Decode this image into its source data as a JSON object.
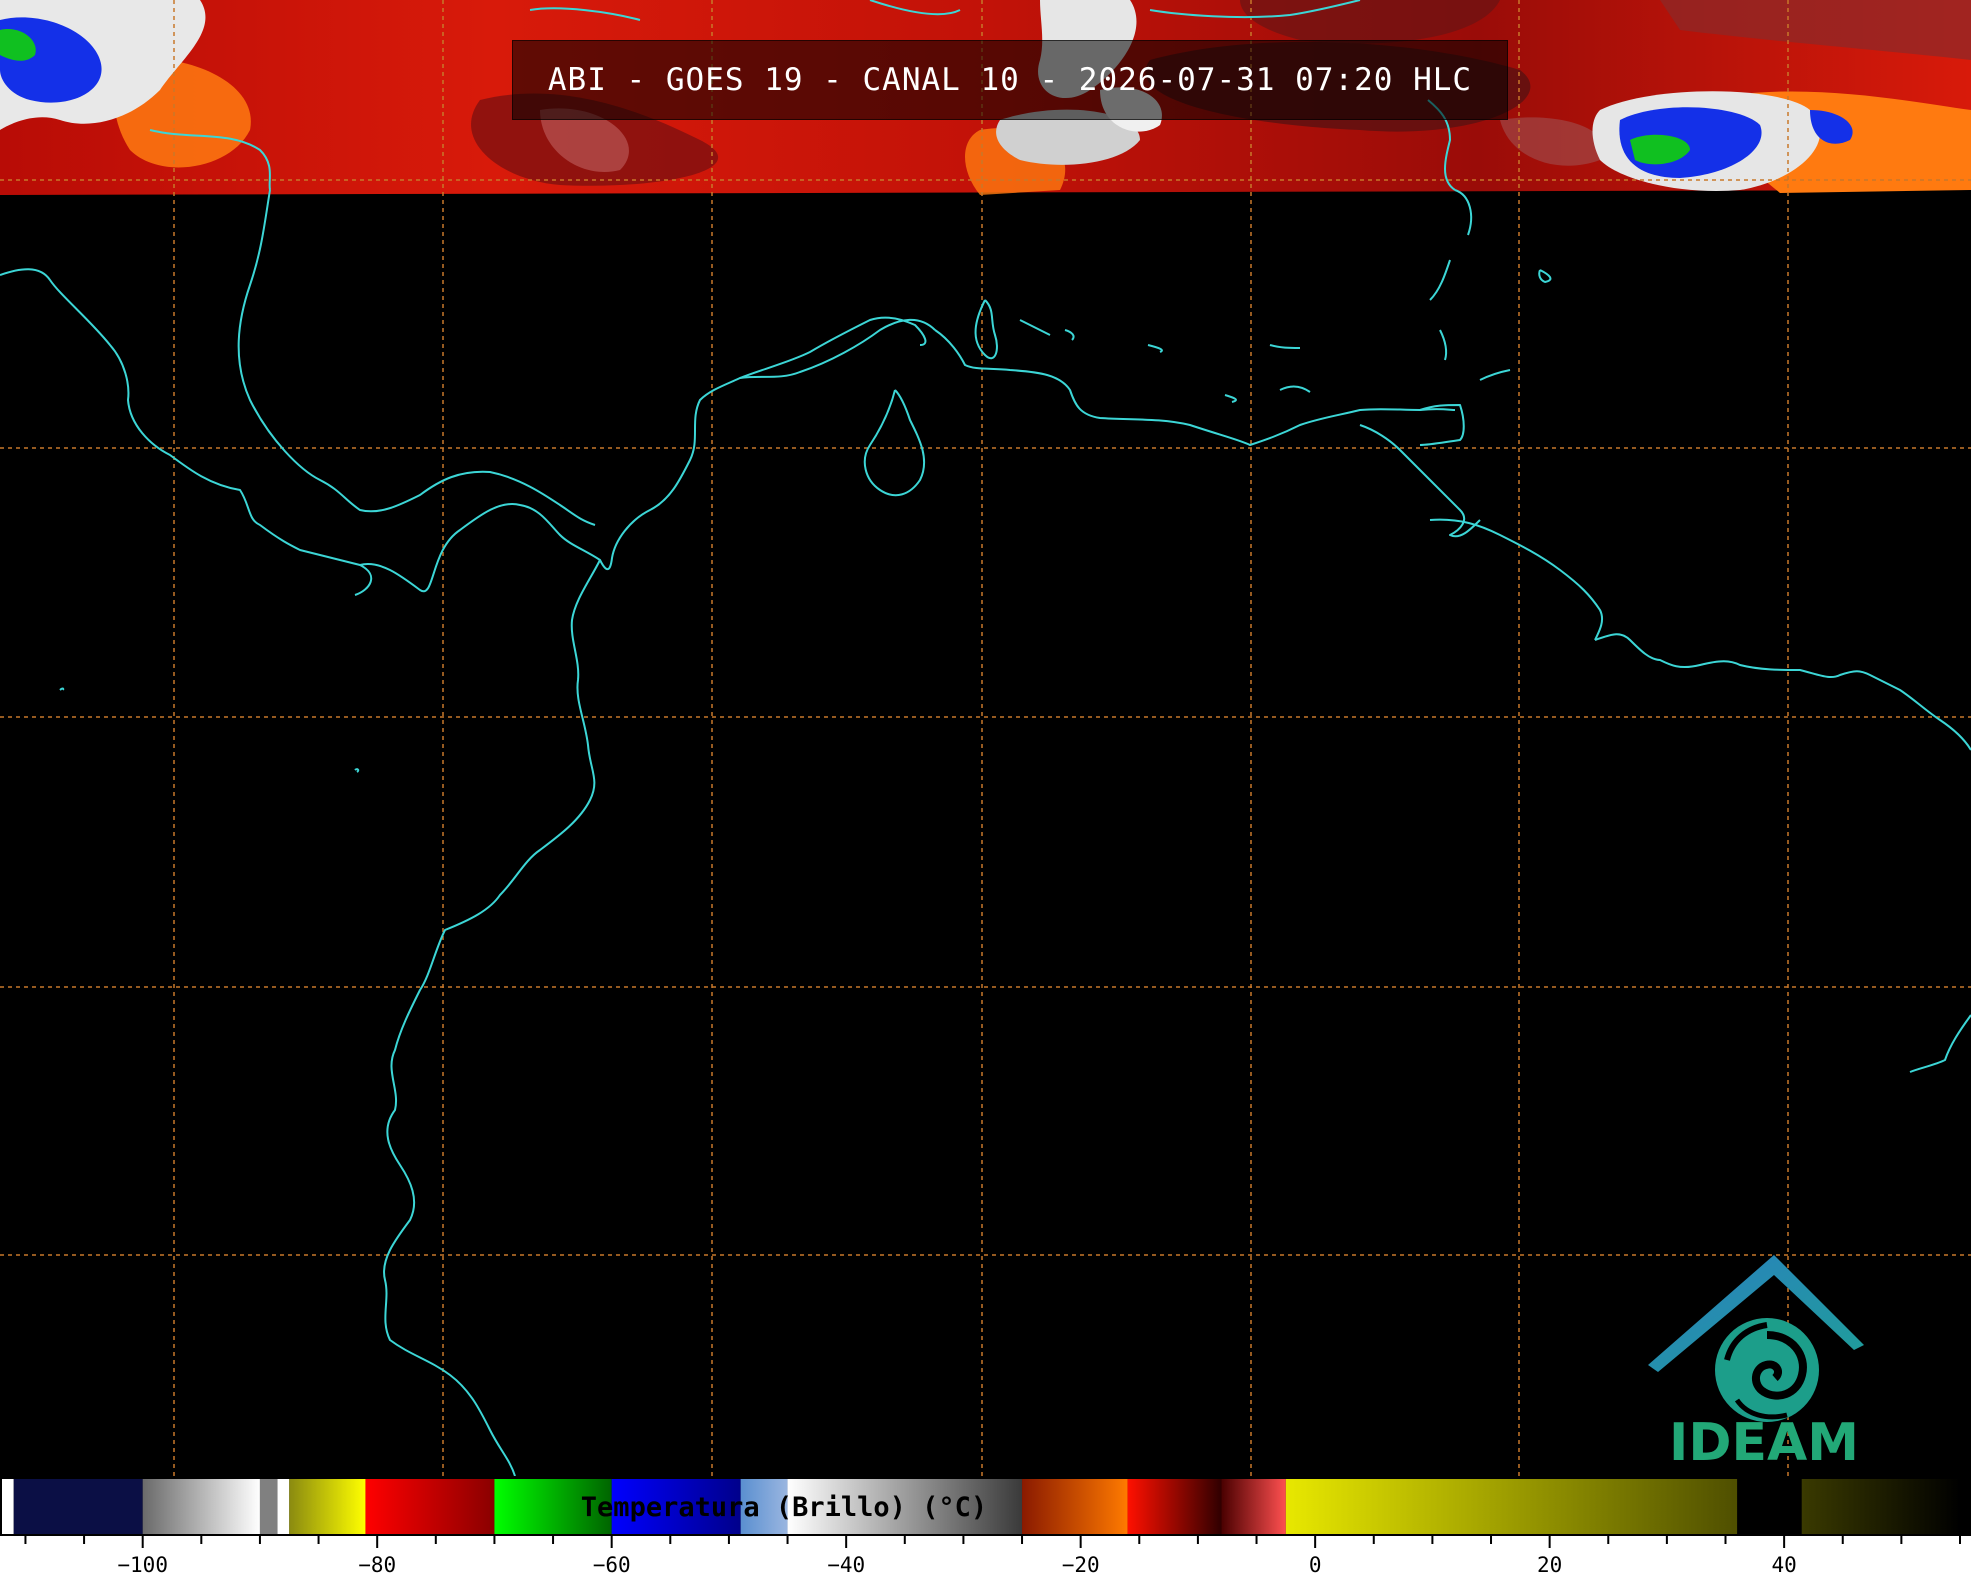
{
  "title": "ABI - GOES 19 - CANAL 10 - 2026-07-31 07:20 HLC",
  "logo_text": "IDEAM",
  "colorbar": {
    "label": "Temperatura (Brillo) (°C)",
    "min": -112,
    "max": 55,
    "tick_labels": [
      {
        "value": -100,
        "label": "−100"
      },
      {
        "value": -80,
        "label": "−80"
      },
      {
        "value": -60,
        "label": "−60"
      },
      {
        "value": -40,
        "label": "−40"
      },
      {
        "value": -20,
        "label": "−20"
      },
      {
        "value": 0,
        "label": "0"
      },
      {
        "value": 20,
        "label": "20"
      },
      {
        "value": 40,
        "label": "40"
      }
    ],
    "stops": [
      {
        "from": -112,
        "to": -111,
        "color": "#ffffff"
      },
      {
        "from": -111,
        "to": -100,
        "color": "#0b0f45"
      },
      {
        "from": -100,
        "to": -90,
        "gradient": [
          "#6a6a6a",
          "#ffffff"
        ]
      },
      {
        "from": -90,
        "to": -88.5,
        "color": "#808080"
      },
      {
        "from": -88.5,
        "to": -87.5,
        "color": "#ffffff"
      },
      {
        "from": -87.5,
        "to": -81,
        "gradient": [
          "#8a8a10",
          "#ffff00"
        ]
      },
      {
        "from": -81,
        "to": -70,
        "gradient": [
          "#ff0000",
          "#8a0000"
        ]
      },
      {
        "from": -70,
        "to": -60,
        "gradient": [
          "#00ff00",
          "#006400"
        ]
      },
      {
        "from": -60,
        "to": -49,
        "gradient": [
          "#0000ff",
          "#00008b"
        ]
      },
      {
        "from": -49,
        "to": -45,
        "gradient": [
          "#5a8fd0",
          "#9ab6e0"
        ]
      },
      {
        "from": -45,
        "to": -25,
        "gradient": [
          "#ffffff",
          "#3a3a3a"
        ]
      },
      {
        "from": -25,
        "to": -16,
        "gradient": [
          "#8a1a00",
          "#ff7a00"
        ]
      },
      {
        "from": -16,
        "to": -8,
        "gradient": [
          "#ff1000",
          "#300000"
        ]
      },
      {
        "from": -8,
        "to": -2.5,
        "gradient": [
          "#4a0000",
          "#ff5050"
        ]
      },
      {
        "from": -2.5,
        "to": 36,
        "gradient": [
          "#e8e800",
          "#4f4f00"
        ]
      },
      {
        "from": 36,
        "to": 41.5,
        "color": "#000000"
      },
      {
        "from": 41.5,
        "to": 55,
        "gradient": [
          "#3a3a00",
          "#000000"
        ]
      }
    ]
  },
  "map": {
    "coastline_color": "#3cd6d6",
    "grid_color": "#c8782a",
    "cloud_palette": {
      "red": "#d81a0a",
      "dark_red": "#5a0a08",
      "orange": "#ff7a10",
      "white": "#f4f4f4",
      "blue": "#1430e8",
      "green": "#10c020"
    }
  }
}
